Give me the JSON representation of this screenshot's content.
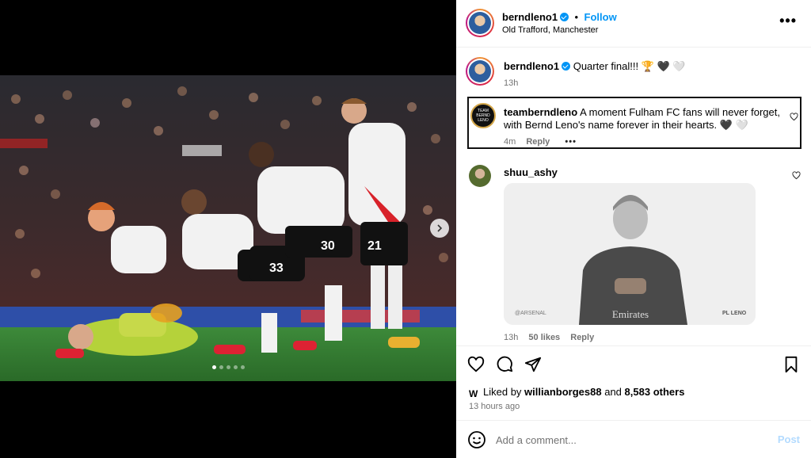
{
  "post": {
    "username": "berndleno1",
    "follow_label": "Follow",
    "separator": "•",
    "location": "Old Trafford, Manchester",
    "more_label": "•••"
  },
  "caption": {
    "username": "berndleno1",
    "text": "Quarter final!!! 🏆 🖤 🤍",
    "time": "13h"
  },
  "comments": [
    {
      "username": "teamberndleno",
      "avatar_text": "TEAM BERND LENO",
      "text": "A moment Fulham FC fans will never forget, with Bernd Leno's name forever in their hearts. 🖤 🤍",
      "time": "4m",
      "reply_label": "Reply",
      "more_label": "•••"
    },
    {
      "username": "shuu_ashy",
      "gif_watermark_left": "@ARSENAL",
      "gif_watermark_right": "PL LENO",
      "shirt_text": "Emirates",
      "time": "13h",
      "likes": "50 likes",
      "reply_label": "Reply"
    }
  ],
  "likes": {
    "prefix": "Liked by",
    "user": "willianborges88",
    "middle": "and",
    "others": "8,583 others"
  },
  "timestamp": "13 hours ago",
  "add_comment": {
    "placeholder": "Add a comment...",
    "post_label": "Post"
  },
  "carousel": {
    "total_slides": 5,
    "active_slide": 1
  },
  "photo": {
    "jersey_numbers": [
      "30",
      "21",
      "33"
    ]
  },
  "colors": {
    "accent": "#0095f6",
    "secondary_text": "#737373",
    "post_disabled": "#b3dbff"
  },
  "icons": {
    "like": "heart-outline-icon",
    "comment": "comment-bubble-icon",
    "share": "paper-plane-icon",
    "save": "bookmark-icon",
    "emoji": "smiley-icon",
    "next": "chevron-right-icon",
    "verified": "verified-badge-icon"
  }
}
